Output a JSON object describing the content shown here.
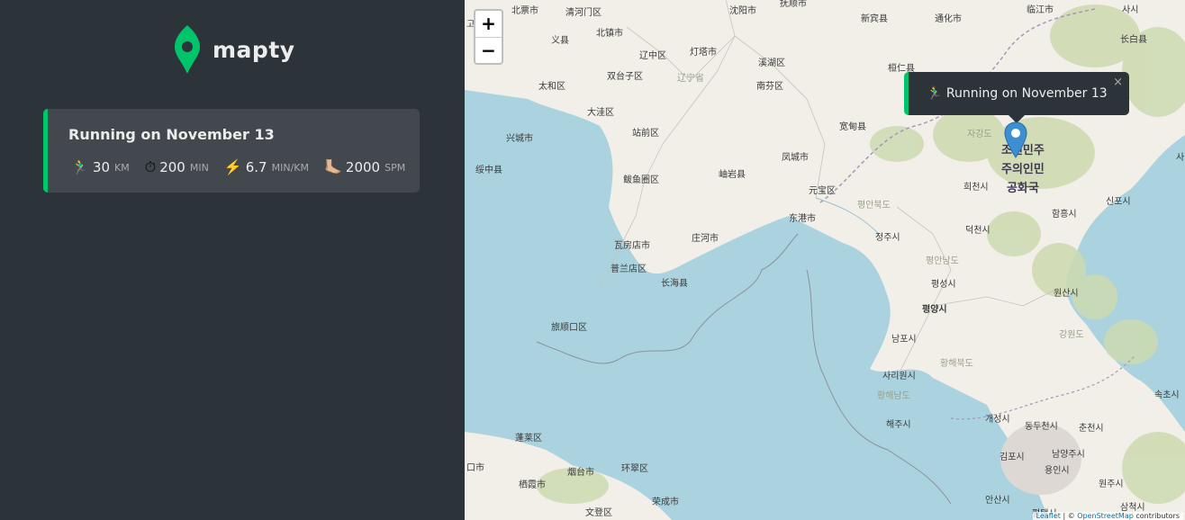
{
  "brand": {
    "name": "mapty",
    "accent": "#00c46a"
  },
  "workout": {
    "title": "Running on November 13",
    "type_icon": "🏃",
    "distance": {
      "icon": "🏃‍♂️",
      "value": "30",
      "unit": "km"
    },
    "duration": {
      "icon": "⏱",
      "value": "200",
      "unit": "min"
    },
    "pace": {
      "icon": "⚡️",
      "value": "6.7",
      "unit": "min/km"
    },
    "cadence": {
      "icon": "🦶🏼",
      "value": "2000",
      "unit": "spm"
    }
  },
  "map": {
    "zoom_in": "+",
    "zoom_out": "−",
    "popup": {
      "icon": "🏃‍♂️",
      "text": "Running on November 13",
      "close": "×"
    },
    "attribution": {
      "leaflet": "Leaflet",
      "separator": " | © ",
      "osm": "OpenStreetMap",
      "suffix": " contributors"
    },
    "labels": {
      "l1": "北票市",
      "l2": "清河门区",
      "l3": "沈阳市",
      "l4": "抚顺市",
      "l5": "新宾县",
      "l6": "通化市",
      "l7": "临江市",
      "l8": "义县",
      "l9": "北镇市",
      "l10": "辽中区",
      "l11": "灯塔市",
      "l12": "溪湖区",
      "l13": "桓仁县",
      "l14": "长白县",
      "l15": "太和区",
      "l16": "双台子区",
      "l17": "辽宁省",
      "l18": "南芬区",
      "l19": "大洼区",
      "l20": "站前区",
      "l21": "宽甸县",
      "l22": "兴城市",
      "l23": "绥中县",
      "l24": "鲅鱼圈区",
      "l25": "岫岩县",
      "l26": "凤城市",
      "l27": "元宝区",
      "l28": "东港市",
      "l29": "瓦房店市",
      "l30": "庄河市",
      "l31": "普兰店区",
      "l32": "长海县",
      "l33": "旅顺口区",
      "l34": "蓬莱区",
      "l35": "烟台市",
      "l36": "环翠区",
      "l37": "栖霞市",
      "l38": "荣成市",
      "l39": "文登区",
      "l40": "口市",
      "l41": "자강도",
      "l42": "희천시",
      "l43": "평안북도",
      "l44": "정주시",
      "l45": "덕천시",
      "l46": "함흥시",
      "l47": "신포시",
      "l48": "평안남도",
      "l49": "평성시",
      "l50": "평양시",
      "l51": "원산시",
      "l52": "남포시",
      "l53": "강원도",
      "l54": "사리원시",
      "l55": "황해북도",
      "l56": "황해남도",
      "l57": "해주시",
      "l58": "개성시",
      "l59": "동두천시",
      "l60": "춘천시",
      "l61": "속초시",
      "l62": "김포시",
      "l63": "남양주시",
      "l64": "용인시",
      "l65": "원주시",
      "l66": "안산시",
      "l67": "평택시",
      "l68": "사시",
      "l69": "삼척시",
      "l70": "사시",
      "l71": "고",
      "country_line1": "조선민주",
      "country_line2": "주의인민",
      "country_line3": "공화국"
    }
  }
}
